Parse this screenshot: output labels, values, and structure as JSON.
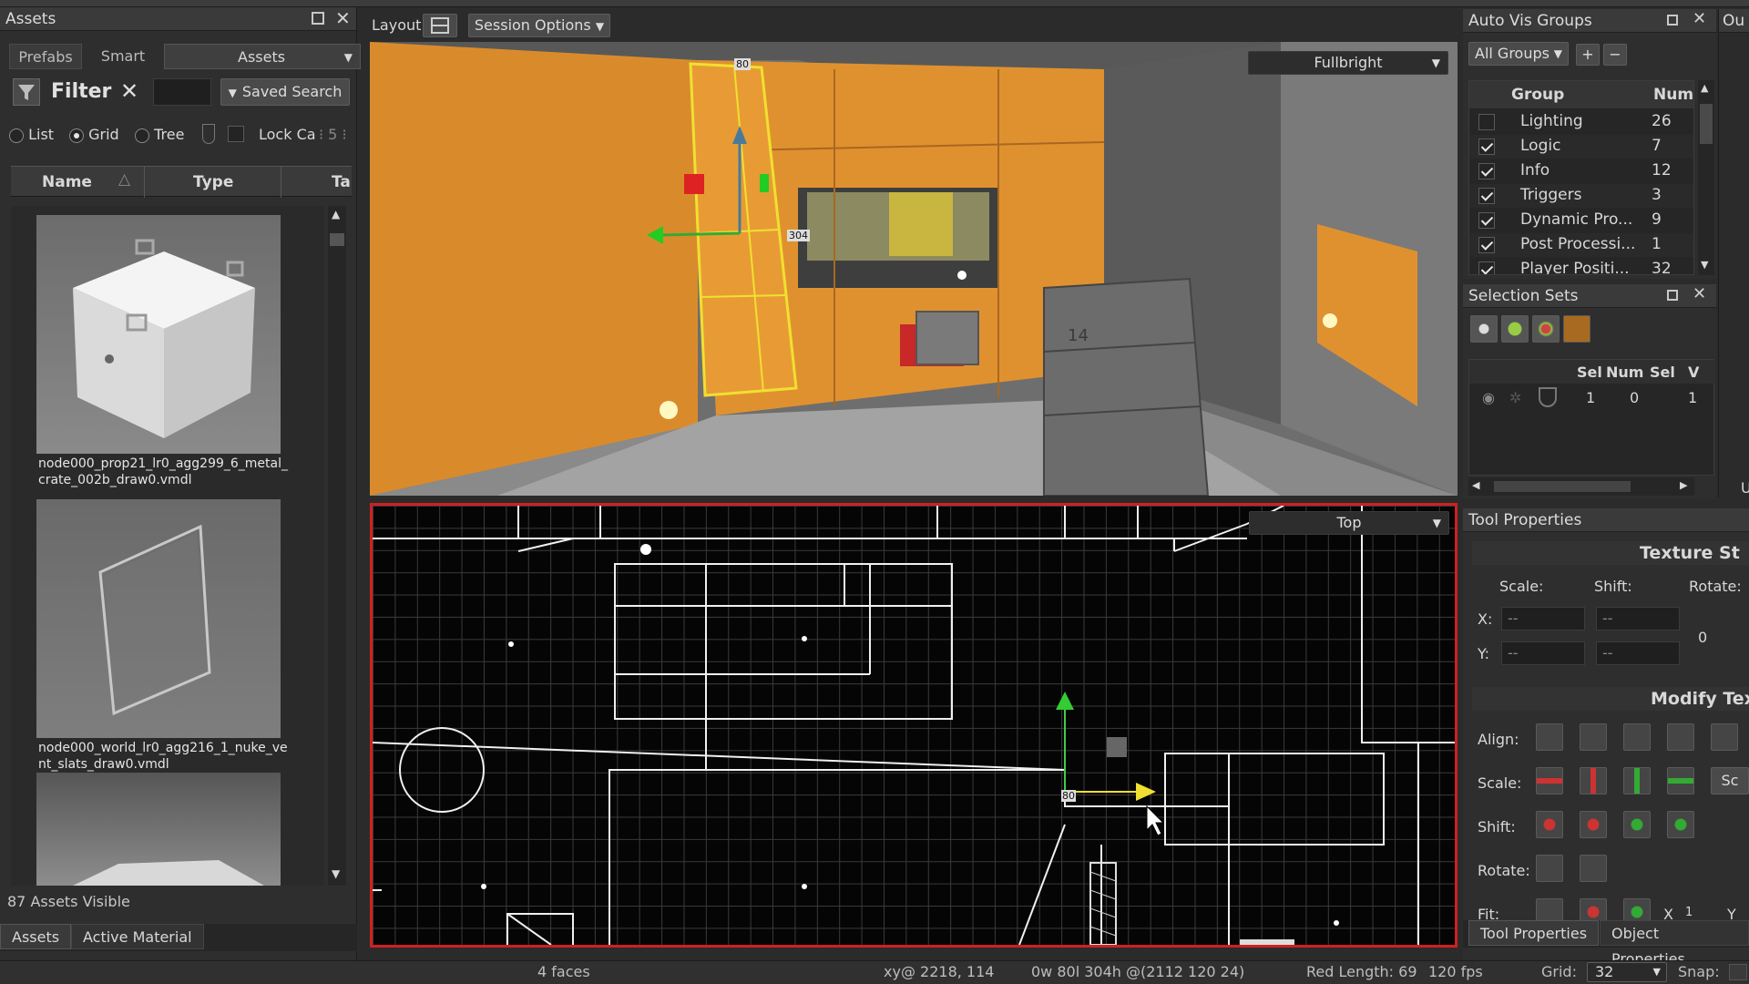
{
  "assets_panel": {
    "title": "Assets",
    "tabs": [
      "Prefabs",
      "Smart",
      "Assets"
    ],
    "filter_label": "Filter",
    "saved_search_label": "Saved Search",
    "view_modes": [
      "List",
      "Grid",
      "Tree"
    ],
    "selected_view": "Grid",
    "lock_label": "Lock Ca",
    "columns": [
      "Name",
      "Type",
      "Ta"
    ],
    "items": [
      {
        "name": "node000_prop21_lr0_agg299_6_metal_crate_002b_draw0.vmdl"
      },
      {
        "name": "node000_world_lr0_agg216_1_nuke_vent_slats_draw0.vmdl"
      }
    ],
    "status": "87 Assets Visible",
    "bottom_tabs": [
      "Assets",
      "Active Material"
    ]
  },
  "viewport_toolbar": {
    "layout_label": "Layout:",
    "session_options_label": "Session Options"
  },
  "viewport_3d": {
    "render_mode": "Fullbright",
    "dim_labels": [
      "80",
      "304"
    ],
    "crate_label": "14"
  },
  "viewport_2d": {
    "view": "Top",
    "dim_label": "80"
  },
  "auto_vis": {
    "title": "Auto Vis Groups",
    "filter": "All Groups",
    "columns": [
      "Group",
      "Num"
    ],
    "groups": [
      {
        "name": "Lighting",
        "num": "26",
        "checked": false
      },
      {
        "name": "Logic",
        "num": "7",
        "checked": true
      },
      {
        "name": "Info",
        "num": "12",
        "checked": true
      },
      {
        "name": "Triggers",
        "num": "3",
        "checked": true
      },
      {
        "name": "Dynamic Pro...",
        "num": "9",
        "checked": true
      },
      {
        "name": "Post Processi...",
        "num": "1",
        "checked": true
      },
      {
        "name": "Player Positi...",
        "num": "32",
        "checked": true
      }
    ]
  },
  "selection_sets": {
    "title": "Selection Sets",
    "columns": [
      "Sel",
      "Num",
      "Sel",
      "V"
    ],
    "row": [
      "1",
      "0",
      "1"
    ]
  },
  "tool_properties": {
    "title": "Tool Properties",
    "texture_section": "Texture St",
    "scale_label": "Scale:",
    "shift_label": "Shift:",
    "rotate_label": "Rotate:",
    "x_label": "X:",
    "y_label": "Y:",
    "placeholder": "--",
    "rotate_value": "0",
    "modify_section": "Modify Tex",
    "rows": [
      "Align:",
      "Scale:",
      "Shift:",
      "Rotate:",
      "Fit:"
    ],
    "fit_x": "X",
    "fit_one": "1",
    "fit_y": "Y",
    "sc_label": "Sc",
    "bottom_tabs": [
      "Tool Properties",
      "Object Properties"
    ]
  },
  "right_edge": {
    "title": "Ou",
    "letter": "U"
  },
  "status_bar": {
    "faces": "4 faces",
    "cursor": "xy@ 2218, 114",
    "selection": "0w 80l 304h @(2112 120 24)",
    "red_length": "Red Length: 69",
    "fps": "120 fps",
    "grid_label": "Grid:",
    "grid_value": "32",
    "snap_label": "Snap:"
  },
  "colors": {
    "panel_bg": "#2b2b2b",
    "wall_orange": "#e0912f",
    "selection_yellow": "#f0e030",
    "viewport_border": "#d02020",
    "grid_bg": "#050505"
  }
}
